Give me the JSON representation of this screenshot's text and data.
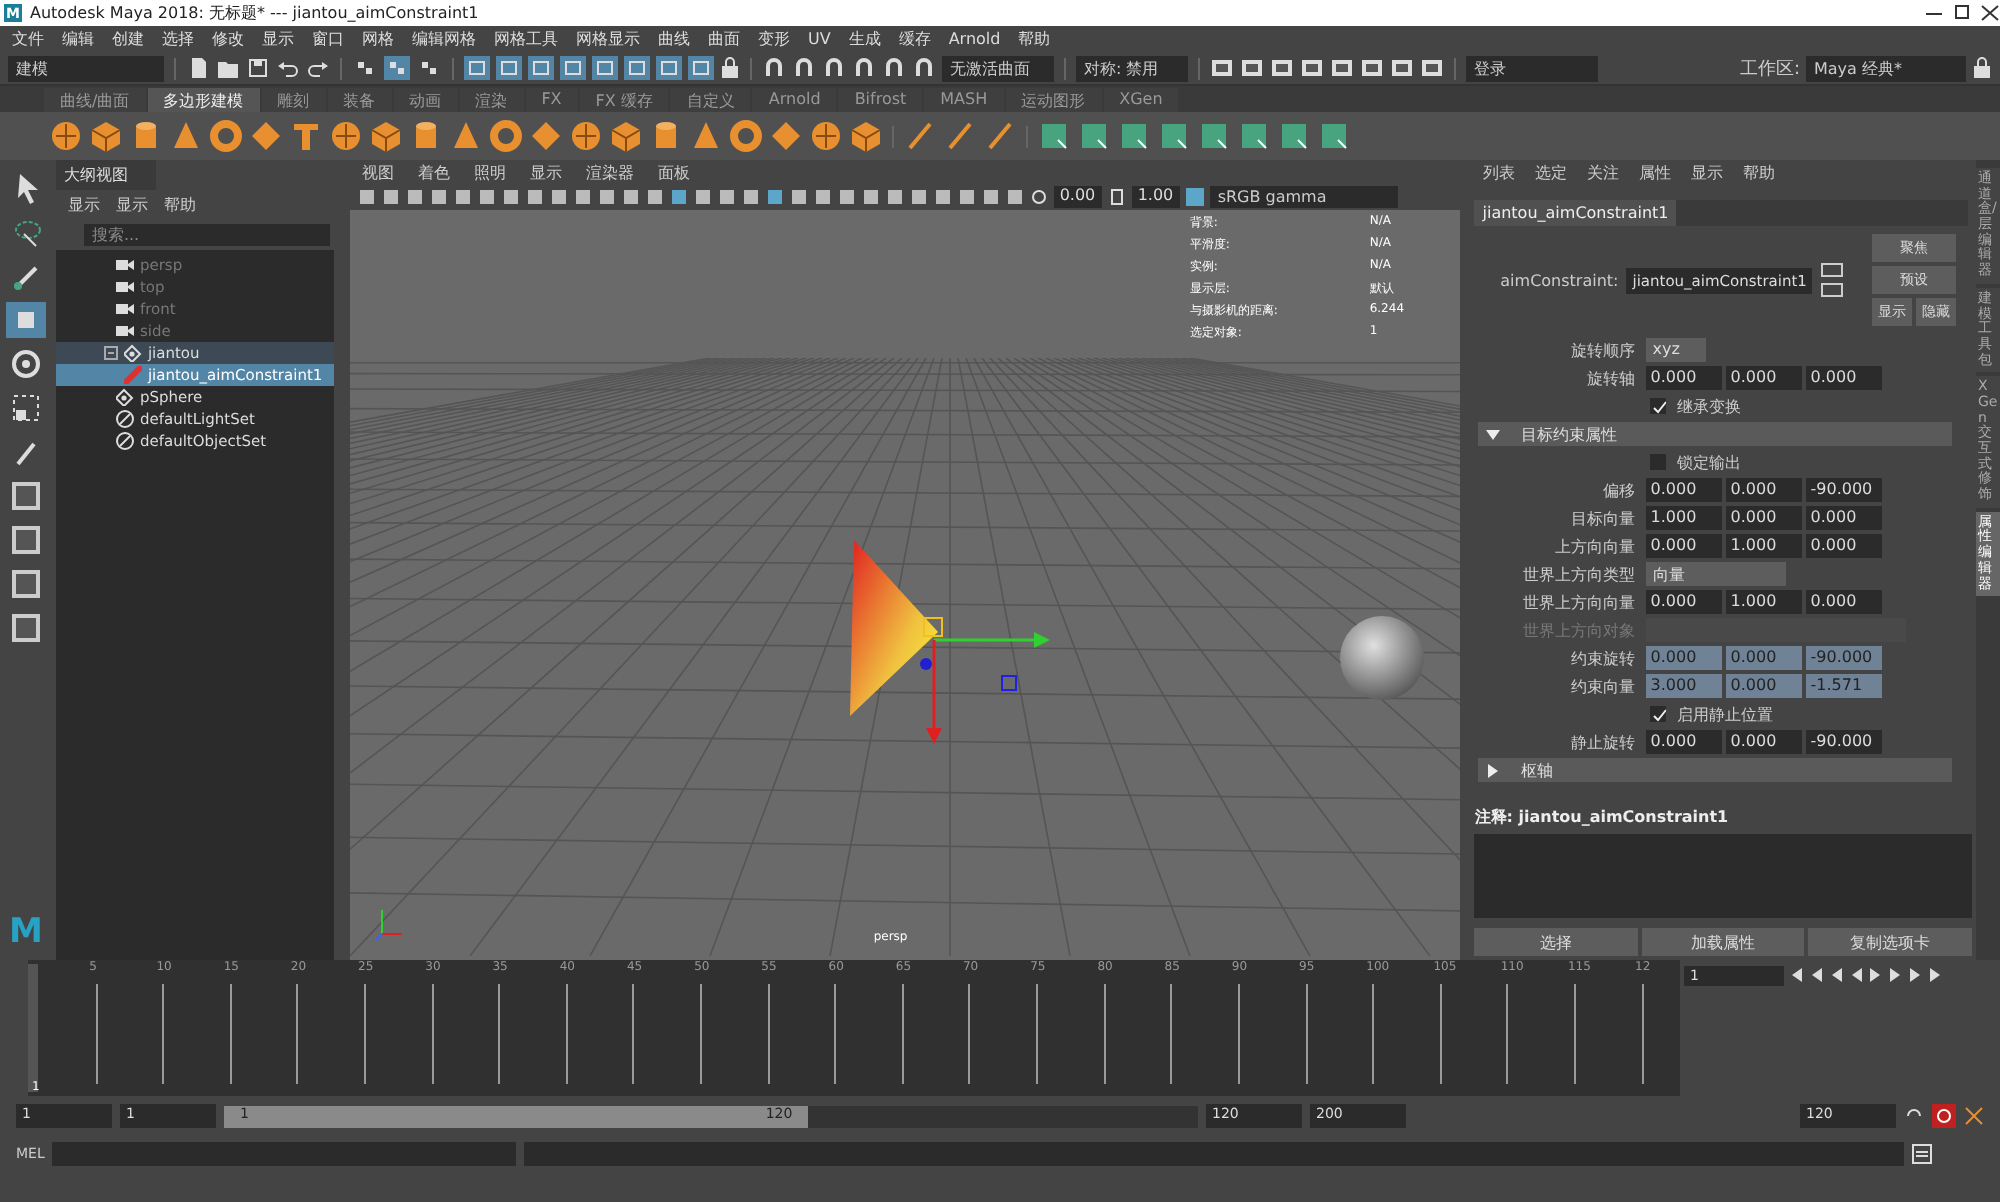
{
  "window": {
    "logo": "M",
    "title": "Autodesk Maya 2018: 无标题*   ---   jiantou_aimConstraint1"
  },
  "toolbox": {
    "logo": "M"
  },
  "menu": [
    "文件",
    "编辑",
    "创建",
    "选择",
    "修改",
    "显示",
    "窗口",
    "网格",
    "编辑网格",
    "网格工具",
    "网格显示",
    "曲线",
    "曲面",
    "变形",
    "UV",
    "生成",
    "缓存",
    "Arnold",
    "帮助"
  ],
  "status_line": {
    "mode": "建模",
    "surface": "无激活曲面",
    "symmetry": "对称: 禁用",
    "login": "登录",
    "workspace_label": "工作区:",
    "workspace": "Maya 经典*"
  },
  "shelf_tabs": [
    {
      "label": "曲线/曲面",
      "selected": false
    },
    {
      "label": "多边形建模",
      "selected": true
    },
    {
      "label": "雕刻",
      "selected": false
    },
    {
      "label": "装备",
      "selected": false
    },
    {
      "label": "动画",
      "selected": false
    },
    {
      "label": "渲染",
      "selected": false
    },
    {
      "label": "FX",
      "selected": false
    },
    {
      "label": "FX 缓存",
      "selected": false
    },
    {
      "label": "自定义",
      "selected": false
    },
    {
      "label": "Arnold",
      "selected": false
    },
    {
      "label": "Bifrost",
      "selected": false
    },
    {
      "label": "MASH",
      "selected": false
    },
    {
      "label": "运动图形",
      "selected": false
    },
    {
      "label": "XGen",
      "selected": false
    }
  ],
  "outliner": {
    "title": "大纲视图",
    "menu": [
      "显示",
      "显示",
      "帮助"
    ],
    "search_placeholder": "搜索...",
    "items": [
      {
        "label": "persp",
        "kind": "camera",
        "dimmed": true,
        "selected": false
      },
      {
        "label": "top",
        "kind": "camera",
        "dimmed": true,
        "selected": false
      },
      {
        "label": "front",
        "kind": "camera",
        "dimmed": true,
        "selected": false
      },
      {
        "label": "side",
        "kind": "camera",
        "dimmed": true,
        "selected": false
      },
      {
        "label": "jiantou",
        "kind": "transform",
        "dimmed": false,
        "selected": false,
        "expanded": true,
        "children": [
          {
            "label": "jiantou_aimConstraint1",
            "kind": "constraint",
            "dimmed": false,
            "selected": true
          }
        ]
      },
      {
        "label": "pSphere",
        "kind": "transform",
        "dimmed": false,
        "selected": false
      },
      {
        "label": "defaultLightSet",
        "kind": "set",
        "dimmed": false,
        "selected": false
      },
      {
        "label": "defaultObjectSet",
        "kind": "set",
        "dimmed": false,
        "selected": false
      }
    ]
  },
  "viewport": {
    "menu": [
      "视图",
      "着色",
      "照明",
      "显示",
      "渲染器",
      "面板"
    ],
    "exposure": "0.00",
    "gamma": "1.00",
    "color_space": "sRGB gamma",
    "hud": [
      {
        "label": "背景:",
        "value": "N/A"
      },
      {
        "label": "平滑度:",
        "value": "N/A"
      },
      {
        "label": "实例:",
        "value": "N/A"
      },
      {
        "label": "显示层:",
        "value": "默认"
      },
      {
        "label": "与摄影机的距离:",
        "value": "6.244"
      },
      {
        "label": "选定对象:",
        "value": "1"
      }
    ],
    "camera": "persp"
  },
  "attribute_editor": {
    "menu": [
      "列表",
      "选定",
      "关注",
      "属性",
      "显示",
      "帮助"
    ],
    "tab": "jiantou_aimConstraint1",
    "node_label": "aimConstraint:",
    "node_name": "jiantou_aimConstraint1",
    "buttons": [
      "聚焦",
      "预设",
      "显示",
      "隐藏"
    ],
    "rows": [
      {
        "kind": "dropdown",
        "label": "旋转顺序",
        "value": "xyz"
      },
      {
        "kind": "vector",
        "label": "旋转轴",
        "values": [
          "0.000",
          "0.000",
          "0.000"
        ],
        "connected": false
      },
      {
        "kind": "checkbox",
        "label": "继承变换",
        "checked": true
      },
      {
        "kind": "section",
        "label": "目标约束属性",
        "expanded": true
      },
      {
        "kind": "checkbox",
        "label": "锁定输出",
        "checked": false
      },
      {
        "kind": "vector",
        "label": "偏移",
        "values": [
          "0.000",
          "0.000",
          "-90.000"
        ],
        "connected": false
      },
      {
        "kind": "vector",
        "label": "目标向量",
        "values": [
          "1.000",
          "0.000",
          "0.000"
        ],
        "connected": false
      },
      {
        "kind": "vector",
        "label": "上方向向量",
        "values": [
          "0.000",
          "1.000",
          "0.000"
        ],
        "connected": false
      },
      {
        "kind": "dropdown",
        "label": "世界上方向类型",
        "value": "向量"
      },
      {
        "kind": "vector",
        "label": "世界上方向向量",
        "values": [
          "0.000",
          "1.000",
          "0.000"
        ],
        "connected": false
      },
      {
        "kind": "field",
        "label": "世界上方向对象",
        "disabled": true
      },
      {
        "kind": "vector",
        "label": "约束旋转",
        "values": [
          "0.000",
          "0.000",
          "-90.000"
        ],
        "connected": true
      },
      {
        "kind": "vector",
        "label": "约束向量",
        "values": [
          "3.000",
          "0.000",
          "-1.571"
        ],
        "connected": true
      },
      {
        "kind": "checkbox",
        "label": "启用静止位置",
        "checked": true
      },
      {
        "kind": "vector",
        "label": "静止旋转",
        "values": [
          "0.000",
          "0.000",
          "-90.000"
        ],
        "connected": false
      },
      {
        "kind": "section",
        "label": "枢轴",
        "expanded": false
      }
    ],
    "notes_label": "注释:",
    "notes_name": "jiantou_aimConstraint1",
    "bottom_buttons": [
      "选择",
      "加载属性",
      "复制选项卡"
    ]
  },
  "side_tabs": [
    {
      "label": "通道盒/层编辑器",
      "selected": false
    },
    {
      "label": "建模工具包",
      "selected": false
    },
    {
      "label": "XGen交互式修饰",
      "selected": false
    },
    {
      "label": "属性编辑器",
      "selected": true
    }
  ],
  "timeline": {
    "ticks": [
      "5",
      "10",
      "15",
      "20",
      "25",
      "30",
      "35",
      "40",
      "45",
      "50",
      "55",
      "60",
      "65",
      "70",
      "75",
      "80",
      "85",
      "90",
      "95",
      "100",
      "105",
      "110",
      "115",
      "12"
    ],
    "current": "1",
    "frame": "1"
  },
  "range": {
    "level": 0.6,
    "start": "1",
    "playback_start": "1",
    "slider_start": "1",
    "slider_end": "120",
    "playback_end": "120",
    "end": "200",
    "anim_end": "120"
  },
  "command_line": {
    "label": "MEL"
  }
}
